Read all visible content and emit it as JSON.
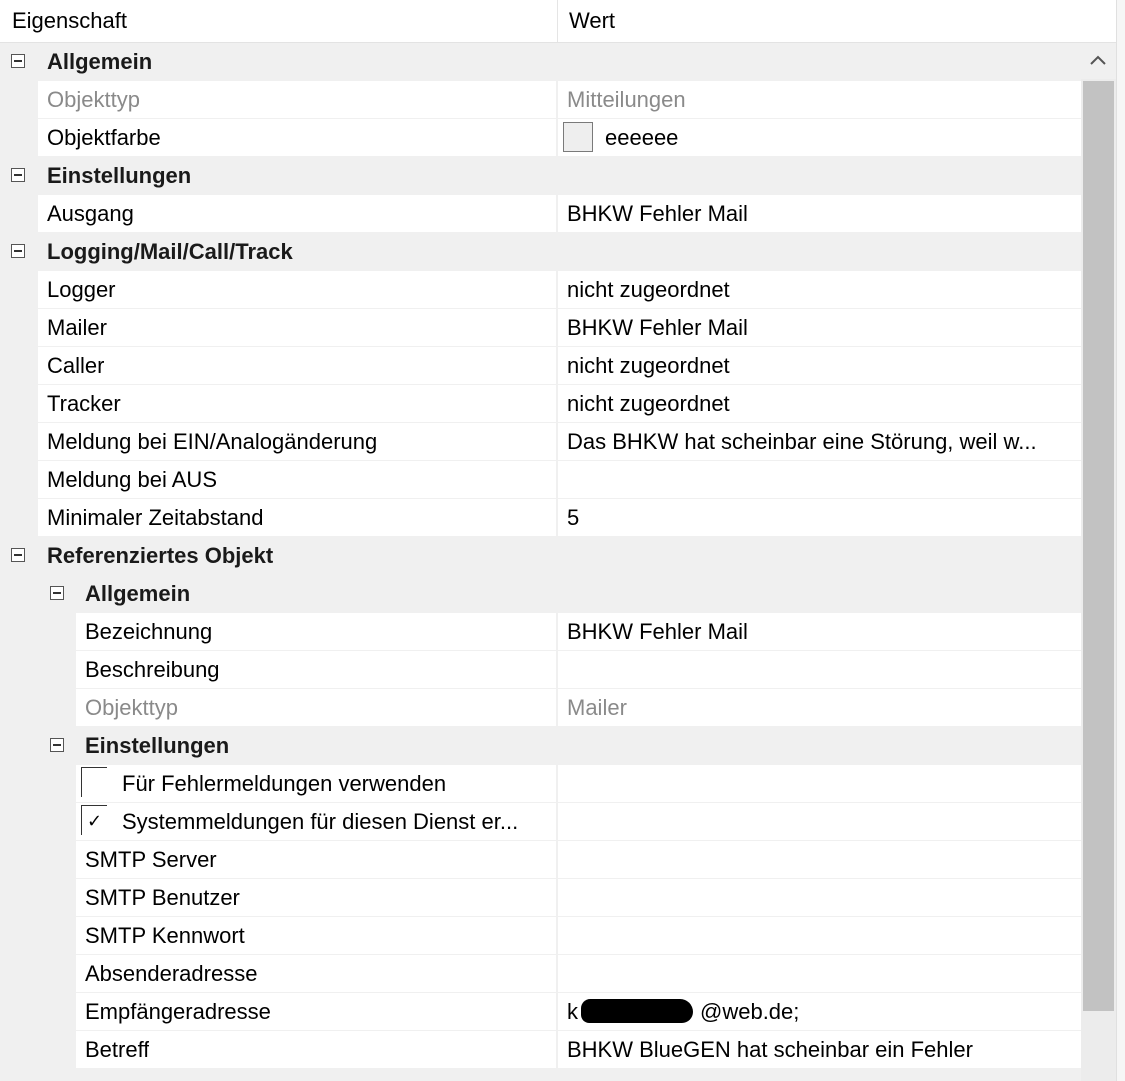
{
  "header": {
    "col_property": "Eigenschaft",
    "col_value": "Wert"
  },
  "sections": {
    "allgemein": {
      "label": "Allgemein",
      "objekttyp": {
        "name": "Objekttyp",
        "value": "Mitteilungen"
      },
      "objektfarbe": {
        "name": "Objektfarbe",
        "value": "eeeeee",
        "swatch_color": "#eeeeee"
      }
    },
    "einstellungen": {
      "label": "Einstellungen",
      "ausgang": {
        "name": "Ausgang",
        "value": "BHKW Fehler Mail"
      }
    },
    "logging": {
      "label": "Logging/Mail/Call/Track",
      "logger": {
        "name": "Logger",
        "value": "nicht zugeordnet"
      },
      "mailer": {
        "name": "Mailer",
        "value": "BHKW Fehler Mail"
      },
      "caller": {
        "name": "Caller",
        "value": "nicht zugeordnet"
      },
      "tracker": {
        "name": "Tracker",
        "value": "nicht zugeordnet"
      },
      "meldung_ein": {
        "name": "Meldung bei EIN/Analogänderung",
        "value": "Das BHKW hat scheinbar eine Störung, weil w..."
      },
      "meldung_aus": {
        "name": "Meldung bei AUS",
        "value": ""
      },
      "zeitabstand": {
        "name": "Minimaler Zeitabstand",
        "value": "5"
      }
    },
    "referenziert": {
      "label": "Referenziertes Objekt",
      "allgemein": {
        "label": "Allgemein",
        "bezeichnung": {
          "name": "Bezeichnung",
          "value": "BHKW Fehler Mail"
        },
        "beschreibung": {
          "name": "Beschreibung",
          "value": ""
        },
        "objekttyp": {
          "name": "Objekttyp",
          "value": "Mailer"
        }
      },
      "einstellungen": {
        "label": "Einstellungen",
        "fehlermeldungen": {
          "name": "Für Fehlermeldungen verwenden",
          "checked": false,
          "check_mark": ""
        },
        "systemmeldungen": {
          "name": "Systemmeldungen für diesen Dienst er...",
          "checked": true,
          "check_mark": "✓"
        },
        "smtp_server": {
          "name": "SMTP Server",
          "value": ""
        },
        "smtp_benutzer": {
          "name": "SMTP Benutzer",
          "value": ""
        },
        "smtp_kennwort": {
          "name": "SMTP Kennwort",
          "value": ""
        },
        "absender": {
          "name": "Absenderadresse",
          "value": ""
        },
        "empfaenger": {
          "name": "Empfängeradresse",
          "value_prefix": "k",
          "value_suffix": "@web.de;"
        },
        "betreff": {
          "name": "Betreff",
          "value": "BHKW BlueGEN hat scheinbar ein Fehler"
        }
      }
    }
  }
}
